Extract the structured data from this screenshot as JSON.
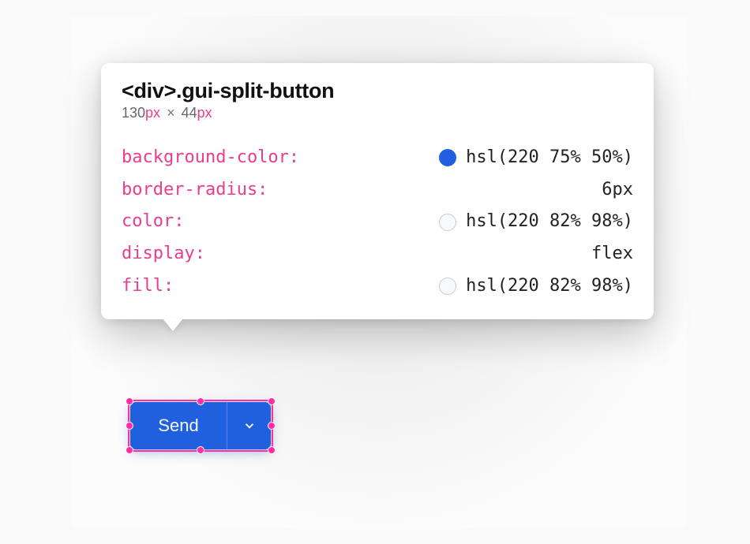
{
  "tooltip": {
    "selector": "<div>.gui-split-button",
    "dims": {
      "w": "130",
      "h": "44",
      "unit": "px"
    },
    "props": [
      {
        "name": "background-color",
        "value": "hsl(220 75% 50%)",
        "swatch": "blue"
      },
      {
        "name": "border-radius",
        "value": "6px",
        "swatch": null
      },
      {
        "name": "color",
        "value": "hsl(220 82% 98%)",
        "swatch": "white"
      },
      {
        "name": "display",
        "value": "flex",
        "swatch": null
      },
      {
        "name": "fill",
        "value": "hsl(220 82% 98%)",
        "swatch": "white"
      }
    ]
  },
  "button": {
    "label": "Send"
  }
}
